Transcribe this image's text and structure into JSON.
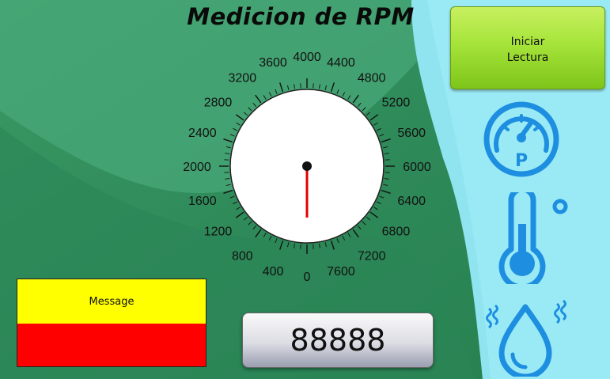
{
  "title": "Medicion de RPM",
  "start_button": {
    "line1": "Iniciar",
    "line2": "Lectura"
  },
  "message": {
    "text": "Message"
  },
  "readout": {
    "value": "88888"
  },
  "gauge": {
    "min": 0,
    "max": 8000,
    "needle_value": 0,
    "labels": [
      "0",
      "400",
      "800",
      "1200",
      "1600",
      "2000",
      "2400",
      "2800",
      "3200",
      "3600",
      "4000",
      "4400",
      "4800",
      "5200",
      "5600",
      "6000",
      "6400",
      "6800",
      "7200",
      "7600"
    ]
  },
  "icons": {
    "pressure": {
      "name": "pressure-gauge-icon",
      "letter": "P"
    },
    "temperature": {
      "name": "thermometer-icon"
    },
    "humidity": {
      "name": "water-drop-icon"
    }
  },
  "colors": {
    "needle": "#e00000",
    "icon_blue": "#1e8fe0",
    "button_green": "#a6e43a",
    "message_yellow": "#ffff00",
    "message_red": "#ff0000"
  }
}
